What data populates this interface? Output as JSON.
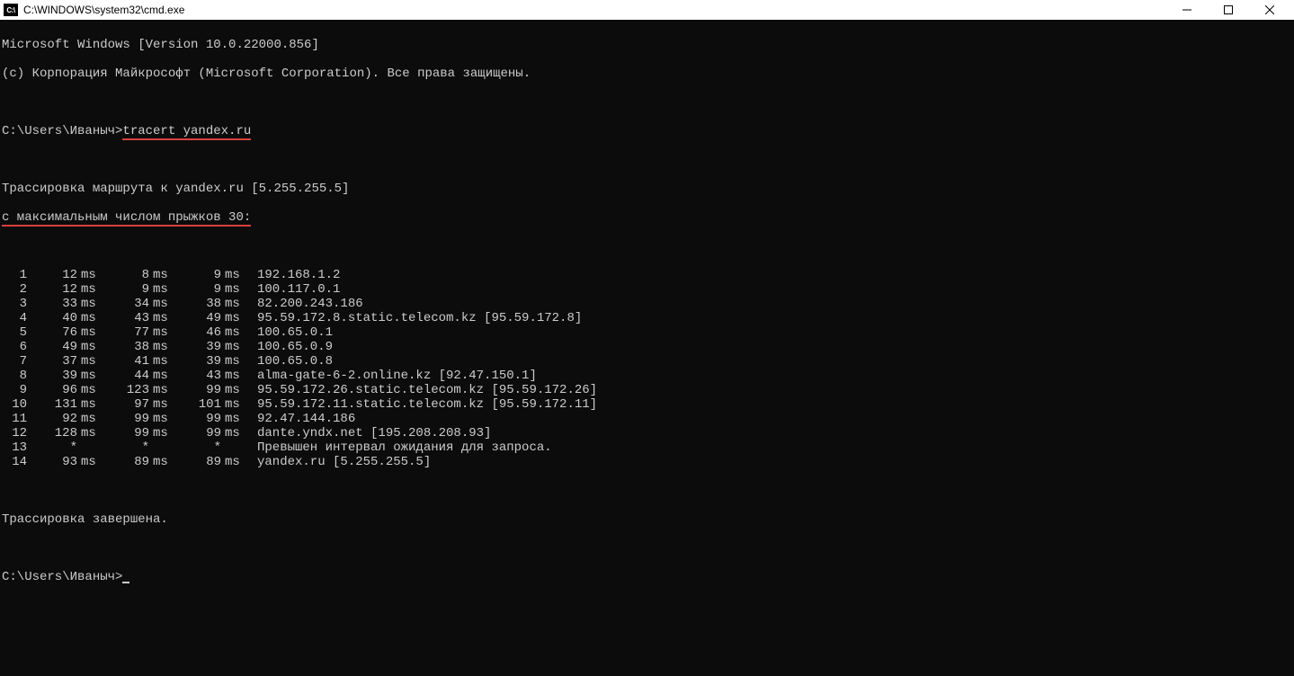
{
  "titlebar": {
    "icon_text": "C:\\",
    "title": "C:\\WINDOWS\\system32\\cmd.exe"
  },
  "header": {
    "version_line": "Microsoft Windows [Version 10.0.22000.856]",
    "copyright_line": "(c) Корпорация Майкрософт (Microsoft Corporation). Все права защищены."
  },
  "prompt1": {
    "path": "C:\\Users\\Иваныч>",
    "command": "tracert yandex.ru"
  },
  "trace_header": {
    "line1": "Трассировка маршрута к yandex.ru [5.255.255.5]",
    "line2": "с максимальным числом прыжков 30:"
  },
  "hops": [
    {
      "n": "1",
      "t1": "12",
      "u1": "ms",
      "t2": "8",
      "u2": "ms",
      "t3": "9",
      "u3": "ms",
      "dest": "192.168.1.2"
    },
    {
      "n": "2",
      "t1": "12",
      "u1": "ms",
      "t2": "9",
      "u2": "ms",
      "t3": "9",
      "u3": "ms",
      "dest": "100.117.0.1"
    },
    {
      "n": "3",
      "t1": "33",
      "u1": "ms",
      "t2": "34",
      "u2": "ms",
      "t3": "38",
      "u3": "ms",
      "dest": "82.200.243.186"
    },
    {
      "n": "4",
      "t1": "40",
      "u1": "ms",
      "t2": "43",
      "u2": "ms",
      "t3": "49",
      "u3": "ms",
      "dest": "95.59.172.8.static.telecom.kz [95.59.172.8]"
    },
    {
      "n": "5",
      "t1": "76",
      "u1": "ms",
      "t2": "77",
      "u2": "ms",
      "t3": "46",
      "u3": "ms",
      "dest": "100.65.0.1"
    },
    {
      "n": "6",
      "t1": "49",
      "u1": "ms",
      "t2": "38",
      "u2": "ms",
      "t3": "39",
      "u3": "ms",
      "dest": "100.65.0.9"
    },
    {
      "n": "7",
      "t1": "37",
      "u1": "ms",
      "t2": "41",
      "u2": "ms",
      "t3": "39",
      "u3": "ms",
      "dest": "100.65.0.8"
    },
    {
      "n": "8",
      "t1": "39",
      "u1": "ms",
      "t2": "44",
      "u2": "ms",
      "t3": "43",
      "u3": "ms",
      "dest": "alma-gate-6-2.online.kz [92.47.150.1]"
    },
    {
      "n": "9",
      "t1": "96",
      "u1": "ms",
      "t2": "123",
      "u2": "ms",
      "t3": "99",
      "u3": "ms",
      "dest": "95.59.172.26.static.telecom.kz [95.59.172.26]"
    },
    {
      "n": "10",
      "t1": "131",
      "u1": "ms",
      "t2": "97",
      "u2": "ms",
      "t3": "101",
      "u3": "ms",
      "dest": "95.59.172.11.static.telecom.kz [95.59.172.11]"
    },
    {
      "n": "11",
      "t1": "92",
      "u1": "ms",
      "t2": "99",
      "u2": "ms",
      "t3": "99",
      "u3": "ms",
      "dest": "92.47.144.186"
    },
    {
      "n": "12",
      "t1": "128",
      "u1": "ms",
      "t2": "99",
      "u2": "ms",
      "t3": "99",
      "u3": "ms",
      "dest": "dante.yndx.net [195.208.208.93]"
    },
    {
      "n": "13",
      "t1": "*",
      "u1": "",
      "t2": "*",
      "u2": "",
      "t3": "*",
      "u3": "",
      "dest": "Превышен интервал ожидания для запроса."
    },
    {
      "n": "14",
      "t1": "93",
      "u1": "ms",
      "t2": "89",
      "u2": "ms",
      "t3": "89",
      "u3": "ms",
      "dest": "yandex.ru [5.255.255.5]"
    }
  ],
  "trace_done": "Трассировка завершена.",
  "prompt2": {
    "path": "C:\\Users\\Иваныч>"
  }
}
